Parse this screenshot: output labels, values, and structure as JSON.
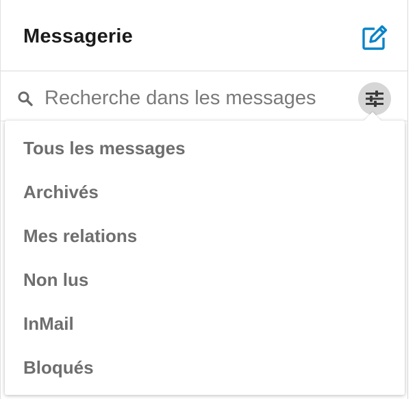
{
  "header": {
    "title": "Messagerie",
    "compose_icon": "compose-edit-icon",
    "accent_color": "#0a84c8"
  },
  "search": {
    "placeholder": "Recherche dans les messages",
    "value": "",
    "search_icon": "search-icon",
    "filter_icon": "filter-sliders-icon"
  },
  "filter_menu": {
    "items": [
      {
        "label": "Tous les messages"
      },
      {
        "label": "Archivés"
      },
      {
        "label": "Mes relations"
      },
      {
        "label": "Non lus"
      },
      {
        "label": "InMail"
      },
      {
        "label": "Bloqués"
      }
    ]
  }
}
